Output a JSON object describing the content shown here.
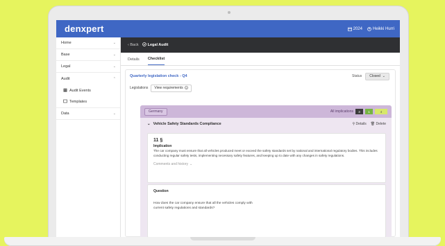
{
  "app": {
    "logo": "denxpert",
    "year": "2024",
    "user_name": "Heikki Hurri"
  },
  "sidebar": {
    "items": [
      {
        "label": "Home"
      },
      {
        "label": "Base"
      },
      {
        "label": "Legal"
      },
      {
        "label": "Audit",
        "children": [
          {
            "label": "Audit Events"
          },
          {
            "label": "Templates"
          }
        ]
      },
      {
        "label": "Data"
      }
    ]
  },
  "header": {
    "back_label": "Back",
    "page_title": "Legal Audit"
  },
  "tabs": [
    {
      "label": "Details"
    },
    {
      "label": "Checklist",
      "active": true
    }
  ],
  "checklist": {
    "title": "Quarterly legislation check - Q4",
    "status_label": "Status",
    "status_value": "Closed",
    "legislations_label": "Legislations",
    "view_requirements_label": "View requirements"
  },
  "requirement": {
    "tag": "Germany",
    "implications_label": "All implications",
    "implication_counts": [
      "3",
      "1",
      "4"
    ],
    "title": "Vehicle Safety Standards Compliance",
    "details_label": "Details",
    "delete_label": "Delete",
    "section": "11 §",
    "implication_heading": "Implication",
    "implication_text": "The car company must ensure that all vehicles produced meet or exceed the safety standards set by national and international regulatory bodies. This includes conducting regular safety tests, implementing necessary safety features, and keeping up to date with any changes in safety regulations.",
    "comments_label": "Comments and history",
    "question_heading": "Question",
    "question_text": "How does the car company ensure that all the vehicles comply with current safety regulations and standards?"
  },
  "colors": {
    "brand_blue": "#3f67c4",
    "background_lime": "#e6f45e",
    "requirement_purple": "#cdb7d9"
  }
}
